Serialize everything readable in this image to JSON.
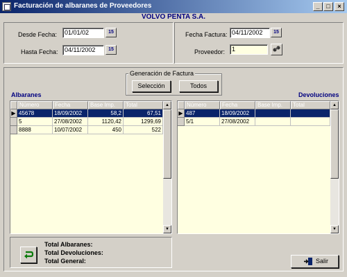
{
  "window": {
    "title": "Facturación de albaranes de Proveedores",
    "buttons": {
      "minimize": "_",
      "maximize": "□",
      "close": "×"
    }
  },
  "company": "VOLVO PENTA S.A.",
  "filters": {
    "desde_label": "Desde Fecha:",
    "desde_value": "01/01/02",
    "hasta_label": "Hasta Fecha:",
    "hasta_value": "04/11/2002",
    "fecha_factura_label": "Fecha Factura:",
    "fecha_factura_value": "04/11/2002",
    "proveedor_label": "Proveedor:",
    "proveedor_value": "1",
    "calendar_icon": "calendar-icon",
    "lookup_icon": "search-icon"
  },
  "generacion": {
    "title": "Generación de Factura",
    "seleccion_label": "Selección",
    "todos_label": "Todos"
  },
  "albaranes": {
    "title": "Albaranes",
    "columns": [
      "Número",
      "Fecha",
      "Base Imp.",
      "Total"
    ],
    "rows": [
      {
        "numero": "45678",
        "fecha": "18/09/2002",
        "base": "58,2",
        "total": "67,51",
        "indicator": "▶",
        "selected": true
      },
      {
        "numero": "5",
        "fecha": "27/08/2002",
        "base": "1120,42",
        "total": "1299,69",
        "indicator": "",
        "selected": false
      },
      {
        "numero": "8888",
        "fecha": "10/07/2002",
        "base": "450",
        "total": "522",
        "indicator": "",
        "selected": false
      }
    ]
  },
  "devoluciones": {
    "title": "Devoluciones",
    "columns": [
      "Número",
      "Fecha",
      "Base Imp.",
      "Total"
    ],
    "rows": [
      {
        "numero": "487",
        "fecha": "18/09/2002",
        "base": "",
        "total": "",
        "indicator": "▶",
        "selected": true
      },
      {
        "numero": "5/1",
        "fecha": "27/08/2002",
        "base": "",
        "total": "",
        "indicator": "",
        "selected": false
      }
    ]
  },
  "totals": {
    "albaranes_label": "Total Albaranes:",
    "devoluciones_label": "Total Devoluciones:",
    "general_label": "Total General:"
  },
  "actions": {
    "refresh_icon": "refresh-arrow-icon",
    "salir_label": "Salir",
    "salir_icon": "exit-door-icon"
  },
  "colors": {
    "selection": "#0a246a",
    "grid_background": "#ffffe1",
    "accent_text": "#000080"
  }
}
